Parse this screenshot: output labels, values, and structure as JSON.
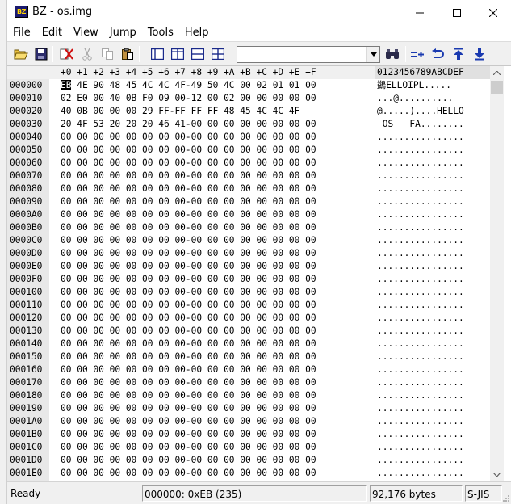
{
  "window": {
    "title": "BZ - os.img",
    "app_icon_label": "BZ",
    "controls": {
      "minimize": "minimize-icon",
      "maximize": "maximize-icon",
      "close": "close-icon"
    }
  },
  "menu": [
    "File",
    "Edit",
    "View",
    "Jump",
    "Tools",
    "Help"
  ],
  "toolbar": {
    "buttons_left": [
      "open-folder-icon",
      "save-icon",
      "cut-marked-icon",
      "cut-icon",
      "copy-icon",
      "paste-icon"
    ],
    "buttons_view": [
      "view-single-icon",
      "view-split-vertical-icon",
      "view-split-horizontal-icon",
      "view-compare-icon"
    ],
    "search_value": "",
    "buttons_right": [
      "find-icon",
      "goto-icon",
      "back-icon",
      "jump-top-icon",
      "jump-bottom-icon"
    ]
  },
  "hex": {
    "header_hex": [
      "+0",
      "+1",
      "+2",
      "+3",
      "+4",
      "+5",
      "+6",
      "+7",
      "+8",
      "+9",
      "+A",
      "+B",
      "+C",
      "+D",
      "+E",
      "+F"
    ],
    "header_ascii": "0123456789ABCDEF",
    "rows": [
      {
        "addr": "000000",
        "bytes": "EB 4E 90 48 45 4C 4C 4F-49 50 4C 00 02 01 01 00",
        "ascii": "鷁ELLOIPL....."
      },
      {
        "addr": "000010",
        "bytes": "02 E0 00 40 0B F0 09 00-12 00 02 00 00 00 00 00",
        "ascii": "...@.........."
      },
      {
        "addr": "000020",
        "bytes": "40 0B 00 00 00 29 FF-FF FF FF 48 45 4C 4C 4F",
        "ascii": "@.....)....HELLO"
      },
      {
        "addr": "000030",
        "bytes": "20 4F 53 20 20 20 46 41-00 00 00 00 00 00 00 00",
        "ascii": " OS   FA........"
      },
      {
        "addr": "000040",
        "bytes": "00 00 00 00 00 00 00 00-00 00 00 00 00 00 00 00",
        "ascii": "................"
      },
      {
        "addr": "000050",
        "bytes": "00 00 00 00 00 00 00 00-00 00 00 00 00 00 00 00",
        "ascii": "................"
      },
      {
        "addr": "000060",
        "bytes": "00 00 00 00 00 00 00 00-00 00 00 00 00 00 00 00",
        "ascii": "................"
      },
      {
        "addr": "000070",
        "bytes": "00 00 00 00 00 00 00 00-00 00 00 00 00 00 00 00",
        "ascii": "................"
      },
      {
        "addr": "000080",
        "bytes": "00 00 00 00 00 00 00 00-00 00 00 00 00 00 00 00",
        "ascii": "................"
      },
      {
        "addr": "000090",
        "bytes": "00 00 00 00 00 00 00 00-00 00 00 00 00 00 00 00",
        "ascii": "................"
      },
      {
        "addr": "0000A0",
        "bytes": "00 00 00 00 00 00 00 00-00 00 00 00 00 00 00 00",
        "ascii": "................"
      },
      {
        "addr": "0000B0",
        "bytes": "00 00 00 00 00 00 00 00-00 00 00 00 00 00 00 00",
        "ascii": "................"
      },
      {
        "addr": "0000C0",
        "bytes": "00 00 00 00 00 00 00 00-00 00 00 00 00 00 00 00",
        "ascii": "................"
      },
      {
        "addr": "0000D0",
        "bytes": "00 00 00 00 00 00 00 00-00 00 00 00 00 00 00 00",
        "ascii": "................"
      },
      {
        "addr": "0000E0",
        "bytes": "00 00 00 00 00 00 00 00-00 00 00 00 00 00 00 00",
        "ascii": "................"
      },
      {
        "addr": "0000F0",
        "bytes": "00 00 00 00 00 00 00 00-00 00 00 00 00 00 00 00",
        "ascii": "................"
      },
      {
        "addr": "000100",
        "bytes": "00 00 00 00 00 00 00 00-00 00 00 00 00 00 00 00",
        "ascii": "................"
      },
      {
        "addr": "000110",
        "bytes": "00 00 00 00 00 00 00 00-00 00 00 00 00 00 00 00",
        "ascii": "................"
      },
      {
        "addr": "000120",
        "bytes": "00 00 00 00 00 00 00 00-00 00 00 00 00 00 00 00",
        "ascii": "................"
      },
      {
        "addr": "000130",
        "bytes": "00 00 00 00 00 00 00 00-00 00 00 00 00 00 00 00",
        "ascii": "................"
      },
      {
        "addr": "000140",
        "bytes": "00 00 00 00 00 00 00 00-00 00 00 00 00 00 00 00",
        "ascii": "................"
      },
      {
        "addr": "000150",
        "bytes": "00 00 00 00 00 00 00 00-00 00 00 00 00 00 00 00",
        "ascii": "................"
      },
      {
        "addr": "000160",
        "bytes": "00 00 00 00 00 00 00 00-00 00 00 00 00 00 00 00",
        "ascii": "................"
      },
      {
        "addr": "000170",
        "bytes": "00 00 00 00 00 00 00 00-00 00 00 00 00 00 00 00",
        "ascii": "................"
      },
      {
        "addr": "000180",
        "bytes": "00 00 00 00 00 00 00 00-00 00 00 00 00 00 00 00",
        "ascii": "................"
      },
      {
        "addr": "000190",
        "bytes": "00 00 00 00 00 00 00 00-00 00 00 00 00 00 00 00",
        "ascii": "................"
      },
      {
        "addr": "0001A0",
        "bytes": "00 00 00 00 00 00 00 00-00 00 00 00 00 00 00 00",
        "ascii": "................"
      },
      {
        "addr": "0001B0",
        "bytes": "00 00 00 00 00 00 00 00-00 00 00 00 00 00 00 00",
        "ascii": "................"
      },
      {
        "addr": "0001C0",
        "bytes": "00 00 00 00 00 00 00 00-00 00 00 00 00 00 00 00",
        "ascii": "................"
      },
      {
        "addr": "0001D0",
        "bytes": "00 00 00 00 00 00 00 00-00 00 00 00 00 00 00 00",
        "ascii": "................"
      },
      {
        "addr": "0001E0",
        "bytes": "00 00 00 00 00 00 00 00-00 00 00 00 00 00 00 00",
        "ascii": "................"
      }
    ]
  },
  "status": {
    "ready": "Ready",
    "position": "000000: 0xEB (235)",
    "size": "92,176 bytes",
    "encoding": "S-JIS"
  }
}
